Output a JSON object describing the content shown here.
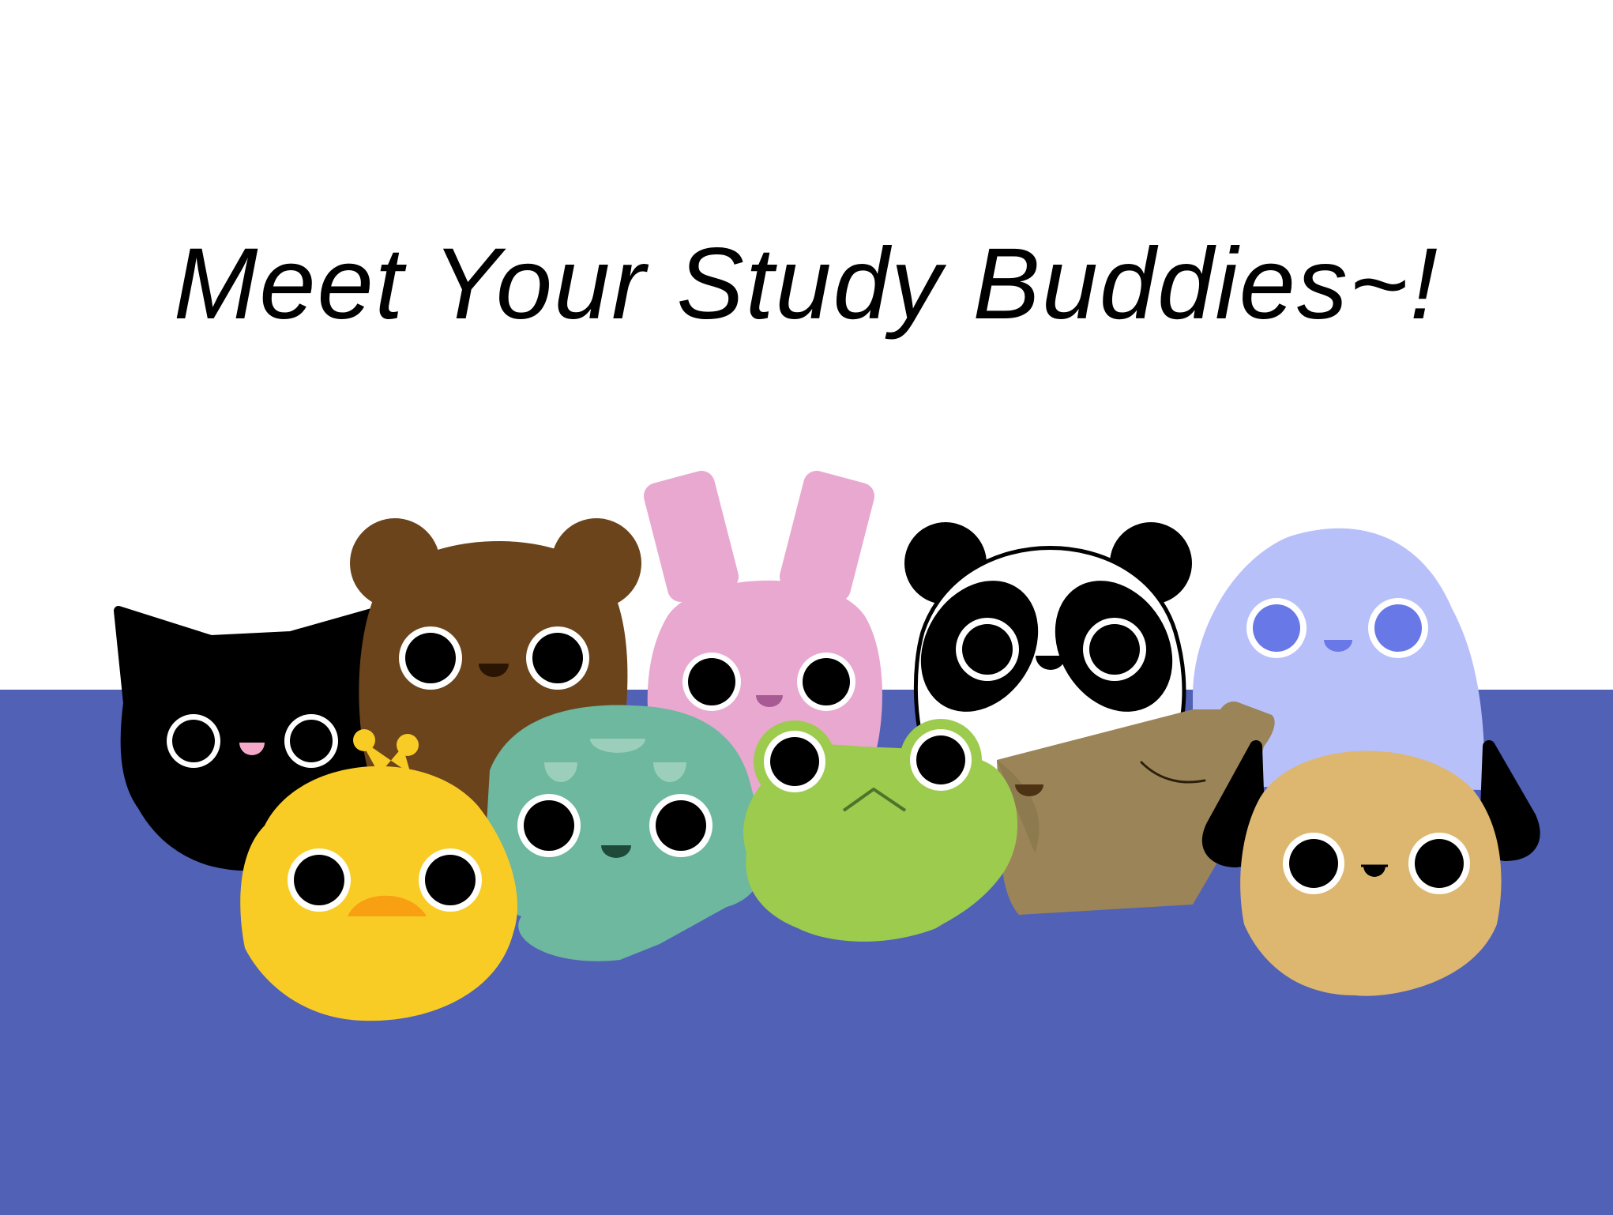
{
  "scene": {
    "title": "Meet Your Study Buddies~!",
    "colors": {
      "background": "#ffffff",
      "floor": "#5061b6"
    }
  },
  "buddies": [
    {
      "name": "cat",
      "color": "#000000"
    },
    {
      "name": "bear",
      "color": "#6b441c"
    },
    {
      "name": "bunny",
      "color": "#e8a8cf"
    },
    {
      "name": "panda",
      "color": "#000000"
    },
    {
      "name": "ghost",
      "color": "#b8c0fa"
    },
    {
      "name": "chick",
      "color": "#f9cc25"
    },
    {
      "name": "turtle",
      "color": "#6db89f"
    },
    {
      "name": "frog",
      "color": "#9ccb4e"
    },
    {
      "name": "sleepy-blob",
      "color": "#9b8458"
    },
    {
      "name": "puppy",
      "color": "#ddb66f"
    }
  ]
}
